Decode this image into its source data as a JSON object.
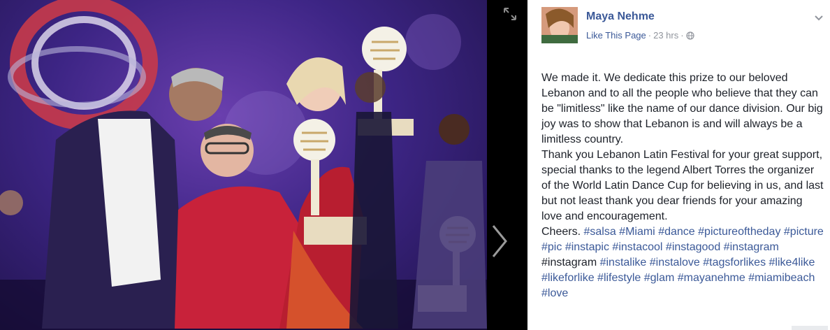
{
  "post": {
    "author": "Maya Nehme",
    "like_page": "Like This Page",
    "separator": "·",
    "time": "23 hrs",
    "globe_separator": "·",
    "body_intro": "We made it. We dedicate this prize to our beloved Lebanon and to all the people who believe that they can be \"limitless\" like the name of our dance division. Our big joy was to show that Lebanon is and will always be a limitless country.\nThank you Lebanon Latin Festival for your great support, special thanks to the legend Albert Torres the organizer of the World Latin Dance Cup for believing in us, and last but not least thank you dear friends for your amazing love and encouragement.\nCheers. ",
    "tokens": [
      {
        "text": "#salsa",
        "link": true
      },
      {
        "text": " "
      },
      {
        "text": "#Miami",
        "link": true
      },
      {
        "text": " "
      },
      {
        "text": "#dance",
        "link": true
      },
      {
        "text": " "
      },
      {
        "text": "#pictureoftheday",
        "link": true
      },
      {
        "text": " "
      },
      {
        "text": "#picture",
        "link": true
      },
      {
        "text": " "
      },
      {
        "text": "#pic",
        "link": true
      },
      {
        "text": " "
      },
      {
        "text": "#instapic",
        "link": true
      },
      {
        "text": " "
      },
      {
        "text": "#instacool",
        "link": true
      },
      {
        "text": " "
      },
      {
        "text": "#instagood",
        "link": true
      },
      {
        "text": " "
      },
      {
        "text": "#instagram",
        "link": true
      },
      {
        "text": " #instagram "
      },
      {
        "text": "#instalike",
        "link": true
      },
      {
        "text": " "
      },
      {
        "text": "#instalove",
        "link": true
      },
      {
        "text": " "
      },
      {
        "text": "#tagsforlikes",
        "link": true
      },
      {
        "text": " "
      },
      {
        "text": "#like4like",
        "link": true
      },
      {
        "text": " "
      },
      {
        "text": "#likeforlike",
        "link": true
      },
      {
        "text": " "
      },
      {
        "text": "#lifestyle",
        "link": true
      },
      {
        "text": " "
      },
      {
        "text": "#glam",
        "link": true
      },
      {
        "text": " "
      },
      {
        "text": "#mayanehme",
        "link": true
      },
      {
        "text": " "
      },
      {
        "text": "#miamibeach",
        "link": true
      },
      {
        "text": " "
      },
      {
        "text": "#love",
        "link": true
      }
    ]
  },
  "icons": {
    "expand": "expand-icon",
    "next": "chevron-right-icon",
    "menu": "chevron-down-icon",
    "privacy": "globe-icon"
  },
  "colors": {
    "link": "#3b5998",
    "meta": "#90949c",
    "text": "#1d2129",
    "viewer_bg": "#000000"
  }
}
